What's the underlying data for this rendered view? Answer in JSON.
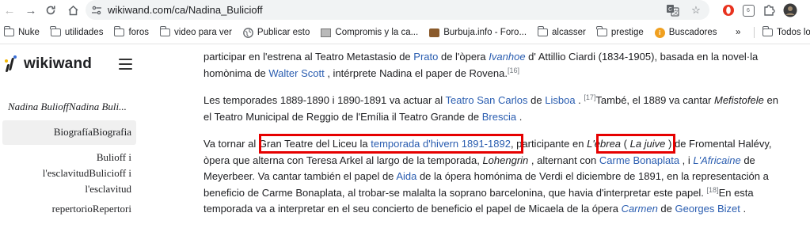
{
  "browser": {
    "url": "wikiwand.com/ca/Nadina_Bulicioff",
    "bookmarks": [
      "Nuke",
      "utilidades",
      "foros",
      "video para ver",
      "Publicar esto",
      "Compromis y la ca...",
      "Burbuja.info - Foro...",
      "alcasser",
      "prestige",
      "Buscadores"
    ],
    "bookmarks_overflow": "»",
    "all_bookmarks": "Todos los",
    "nav_icons": [
      "back-icon",
      "forward-icon",
      "reload-icon",
      "home-icon"
    ],
    "extension_badge": "6"
  },
  "sidebar": {
    "brand": "wikiwand",
    "title": "Nadina BulioffNadina Buli...",
    "items": [
      {
        "label": "BiografíaBiografia",
        "active": true
      },
      {
        "label_lines": [
          "Bulioff i",
          "l'esclavitudBulicioff i",
          "l'esclavitud"
        ]
      },
      {
        "label": "repertorioRepertori"
      }
    ]
  },
  "article": {
    "p1": {
      "l1": [
        "participar en l'estrena al Teatro Metastasio de ",
        "Prato",
        " de l'òpera ",
        "Ivanhoe",
        " d' Attillio Ciardi (1834-1905), basada en la novel·la"
      ],
      "l2": [
        "homònima de ",
        "Walter Scott",
        " , intérprete Nadina el paper de Rovena.",
        "[16]"
      ]
    },
    "p2": {
      "l1": [
        "Les temporades 1889-1890 i 1890-1891 va actuar al ",
        "Teatro San Carlos",
        " de ",
        "Lisboa",
        " . ",
        "[17]",
        "També, el 1889 va cantar ",
        "Mefistofele",
        " en"
      ],
      "l2": [
        "el Teatro Municipal de Reggio de l'Emília il Teatro Grande de ",
        "Brescia",
        " ."
      ]
    },
    "p3": {
      "l1": [
        "Va tornar al ",
        "Gran Teatre del Liceu la ",
        "temporada d'hivern 1891-1892",
        ", participante en ",
        "L'ebrea",
        " ( ",
        "La juive",
        " ) de Fromental Halévy,"
      ],
      "l2": [
        "òpera que alterna con Teresa Arkel al largo de la temporada, ",
        "Lohengrin",
        " , alternant con ",
        "Carme Bonaplata",
        " , i ",
        "L'Africaine",
        " de"
      ],
      "l3": [
        "Meyerbeer. Va cantar también el papel de ",
        "Aida",
        " de la ópera homónima de Verdi el diciembre de 1891, en la representación a"
      ],
      "l4": [
        "beneficio de Carme Bonaplata, al trobar-se malalta la soprano barcelonina, que havia d'interpretar este papel. ",
        "[18]",
        "En esta"
      ],
      "l5": [
        "temporada va a interpretar en el seu concierto de beneficio el papel de Micaela de la ópera ",
        "Carmen",
        " de ",
        "Georges Bizet",
        " ."
      ]
    }
  },
  "colors": {
    "link": "#2a5db0",
    "highlight": "#e60000",
    "active_bg": "#f0f0f0"
  }
}
